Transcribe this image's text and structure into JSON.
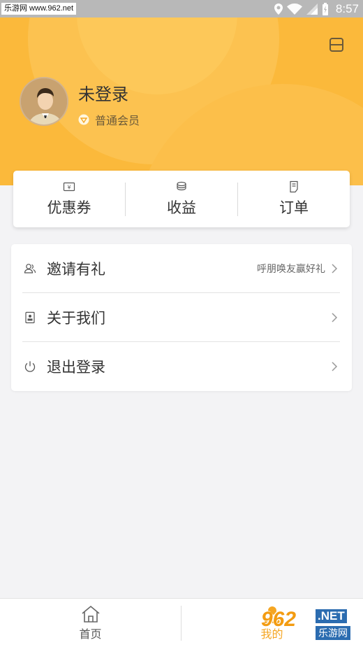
{
  "status_bar": {
    "watermark": "乐游网 www.962.net",
    "time": "8:57"
  },
  "profile": {
    "username": "未登录",
    "member_level": "普通会员"
  },
  "stats": [
    {
      "label": "优惠券",
      "icon": "coupon-icon"
    },
    {
      "label": "收益",
      "icon": "coins-icon"
    },
    {
      "label": "订单",
      "icon": "order-icon"
    }
  ],
  "menu": [
    {
      "label": "邀请有礼",
      "hint": "呼朋唤友赢好礼",
      "icon": "users-icon"
    },
    {
      "label": "关于我们",
      "hint": "",
      "icon": "about-icon"
    },
    {
      "label": "退出登录",
      "hint": "",
      "icon": "power-icon"
    }
  ],
  "tabbar": {
    "home_label": "首页",
    "mine_label": "我的"
  },
  "watermark_bottom": {
    "brand": "962",
    "suffix": ".NET",
    "site": "乐游网"
  },
  "colors": {
    "accent": "#fbb93b",
    "background": "#f3f3f5"
  }
}
